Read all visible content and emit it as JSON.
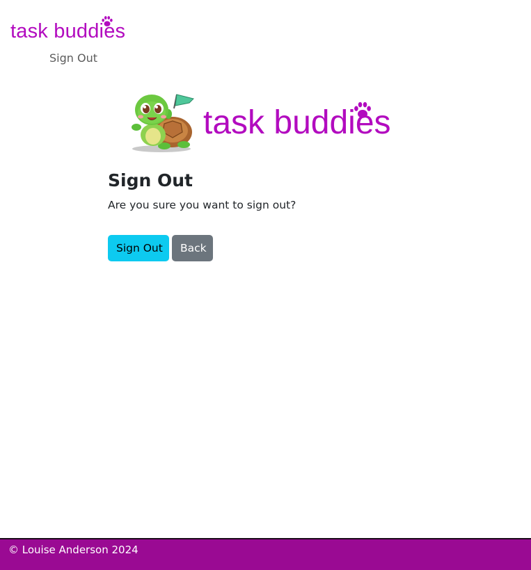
{
  "navbar": {
    "brand_text": "task buddies",
    "links": [
      {
        "label": "Sign Out"
      }
    ]
  },
  "hero": {
    "brand_text": "task buddies",
    "mascot": "turtle-mascot-with-flag"
  },
  "main": {
    "title": "Sign Out",
    "confirm_text": "Are you sure you want to sign out?",
    "buttons": {
      "sign_out_label": "Sign Out",
      "back_label": "Back"
    }
  },
  "footer": {
    "copyright": "© Louise Anderson 2024"
  },
  "colors": {
    "brand": "#b20bbf",
    "footer_bg": "#9a0a93",
    "sign_out_button": "#0dcaf0",
    "back_button": "#6c757d",
    "text": "#212529"
  },
  "icons": {
    "brand_icon": "paw-icon"
  }
}
